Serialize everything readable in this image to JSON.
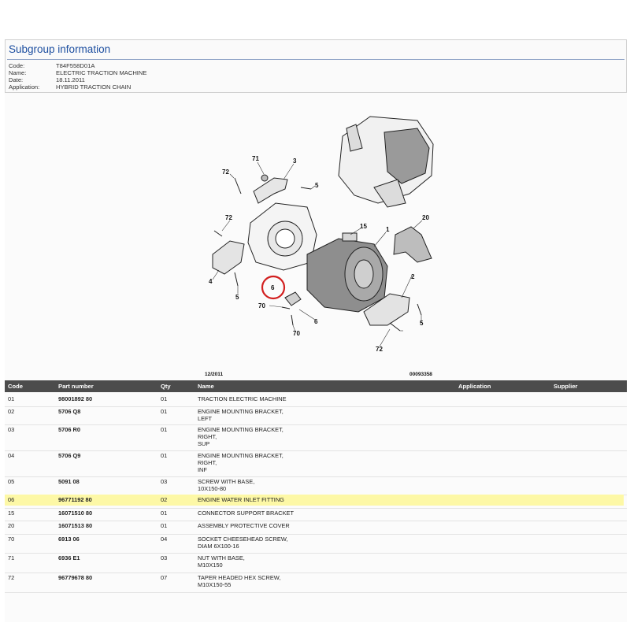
{
  "header": {
    "title": "Subgroup information",
    "fields": [
      {
        "key": "Code:",
        "value": "T84F558D01A"
      },
      {
        "key": "Name:",
        "value": "ELECTRIC TRACTION MACHINE"
      },
      {
        "key": "Date:",
        "value": "18.11.2011"
      },
      {
        "key": "Application:",
        "value": "HYBRID TRACTION CHAIN"
      }
    ]
  },
  "diagram": {
    "callouts": [
      "71",
      "3",
      "72",
      "5",
      "72",
      "15",
      "1",
      "20",
      "4",
      "5",
      "6",
      "2",
      "70",
      "6",
      "5",
      "70",
      "72"
    ],
    "highlighted_callout": "6",
    "highlight_color": "#d21f1f",
    "date_caption": "12/2011",
    "ref_caption": "00093358"
  },
  "table": {
    "columns": [
      "Code",
      "Part number",
      "Qty",
      "Name",
      "Application",
      "Supplier"
    ],
    "rows": [
      {
        "code": "01",
        "part": "98001892 80",
        "qty": "01",
        "name": "TRACTION ELECTRIC MACHINE"
      },
      {
        "code": "02",
        "part": "5706 Q8",
        "qty": "01",
        "name": "ENGINE MOUNTING BRACKET,\nLEFT"
      },
      {
        "code": "03",
        "part": "5706 R0",
        "qty": "01",
        "name": "ENGINE MOUNTING BRACKET,\nRIGHT,\nSUP"
      },
      {
        "code": "04",
        "part": "5706 Q9",
        "qty": "01",
        "name": "ENGINE MOUNTING BRACKET,\nRIGHT,\nINF"
      },
      {
        "code": "05",
        "part": "5091 08",
        "qty": "03",
        "name": "SCREW WITH BASE,\n10X150-80"
      },
      {
        "code": "06",
        "part": "96771192 80",
        "qty": "02",
        "name": "ENGINE WATER INLET FITTING"
      },
      {
        "code": "15",
        "part": "16071510 80",
        "qty": "01",
        "name": "CONNECTOR SUPPORT BRACKET"
      },
      {
        "code": "20",
        "part": "16071513 80",
        "qty": "01",
        "name": "ASSEMBLY PROTECTIVE COVER"
      },
      {
        "code": "70",
        "part": "6913 06",
        "qty": "04",
        "name": "SOCKET CHEESEHEAD SCREW,\nDIAM 6X100-16"
      },
      {
        "code": "71",
        "part": "6936 E1",
        "qty": "03",
        "name": "NUT WITH BASE,\nM10X150"
      },
      {
        "code": "72",
        "part": "96779678 80",
        "qty": "07",
        "name": "TAPER HEADED HEX SCREW,\nM10X150-55"
      }
    ],
    "highlight_row_code": "06",
    "highlight_color": "#fdf8a6",
    "header_bg": "#4c4c4c"
  }
}
